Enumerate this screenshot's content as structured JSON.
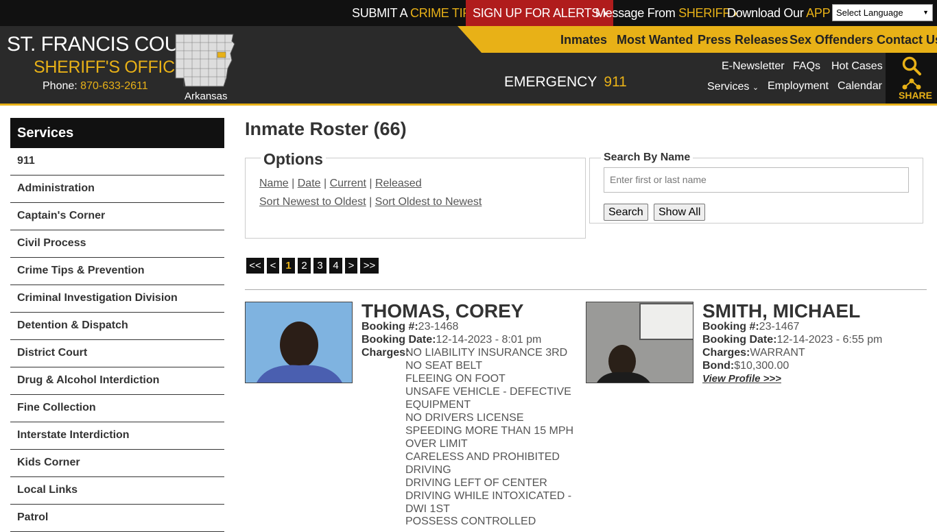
{
  "topbar": {
    "submit": {
      "pre": "SUBMIT A ",
      "hl": "CRIME TIP",
      "chev": "›"
    },
    "alerts": {
      "label": "SIGN UP FOR ALERTS",
      "chev": "›"
    },
    "message": {
      "pre": "Message From ",
      "hl": "SHERIFF",
      "chev": "›"
    },
    "download": {
      "pre": "Download Our ",
      "hl": "APP",
      "chev": "›"
    },
    "language": "Select Language"
  },
  "brand": {
    "line1": "ST. FRANCIS COUNTY",
    "line2": "SHERIFF'S OFFICE",
    "phone_label": "Phone:",
    "phone": "870-633-2611",
    "state": "Arkansas"
  },
  "nav": {
    "primary": [
      "Inmates",
      "Most Wanted",
      "Press Releases",
      "Sex Offenders",
      "Contact Us"
    ],
    "emergency_label": "EMERGENCY",
    "emergency_number": "911",
    "secondary_row1": [
      "E-Newsletter",
      "FAQs",
      "Hot Cases"
    ],
    "services": "Services",
    "secondary_row2": [
      "Employment",
      "Calendar"
    ],
    "share": "SHARE"
  },
  "sidebar": {
    "title": "Services",
    "items": [
      "911",
      "Administration",
      "Captain's Corner",
      "Civil Process",
      "Crime Tips & Prevention",
      "Criminal Investigation Division",
      "Detention & Dispatch",
      "District Court",
      "Drug & Alcohol Interdiction",
      "Fine Collection",
      "Interstate Interdiction",
      "Kids Corner",
      "Local Links",
      "Patrol"
    ]
  },
  "main": {
    "title": "Inmate Roster (66)",
    "options": {
      "legend": "Options",
      "sort_fields": [
        "Name",
        "Date",
        "Current",
        "Released"
      ],
      "sort_orders": [
        "Sort Newest to Oldest",
        "Sort Oldest to Newest"
      ]
    },
    "search": {
      "legend": "Search By Name",
      "placeholder": "Enter first or last name",
      "search_button": "Search",
      "show_all_button": "Show All"
    },
    "pagination": [
      "<<",
      "<",
      "1",
      "2",
      "3",
      "4",
      ">",
      ">>"
    ],
    "inmates": [
      {
        "name": "THOMAS, COREY",
        "booking_label": "Booking #:",
        "booking": "23-1468",
        "date_label": "Booking Date:",
        "date": "12-14-2023 - 8:01 pm",
        "charges_label": "Charges:",
        "charges": [
          "NO LIABILITY INSURANCE 3RD",
          "NO SEAT BELT",
          "FLEEING ON FOOT",
          "UNSAFE VEHICLE - DEFECTIVE",
          "EQUIPMENT",
          "NO DRIVERS LICENSE",
          "SPEEDING MORE THAN 15 MPH",
          "OVER LIMIT",
          "CARELESS AND PROHIBITED",
          "DRIVING",
          "DRIVING LEFT OF CENTER",
          "DRIVING WHILE INTOXICATED -",
          "DWI 1ST",
          "POSSESS CONTROLLED"
        ]
      },
      {
        "name": "SMITH, MICHAEL",
        "booking_label": "Booking #:",
        "booking": "23-1467",
        "date_label": "Booking Date:",
        "date": "12-14-2023 - 6:55 pm",
        "charges_label": "Charges:",
        "charges_value": "WARRANT",
        "bond_label": "Bond:",
        "bond": "$10,300.00",
        "profile_link": "View Profile >>>"
      }
    ]
  },
  "colors": {
    "accent": "#e8b117",
    "alert": "#b01c1c",
    "header": "#2a2a2a",
    "topbar": "#111111"
  }
}
